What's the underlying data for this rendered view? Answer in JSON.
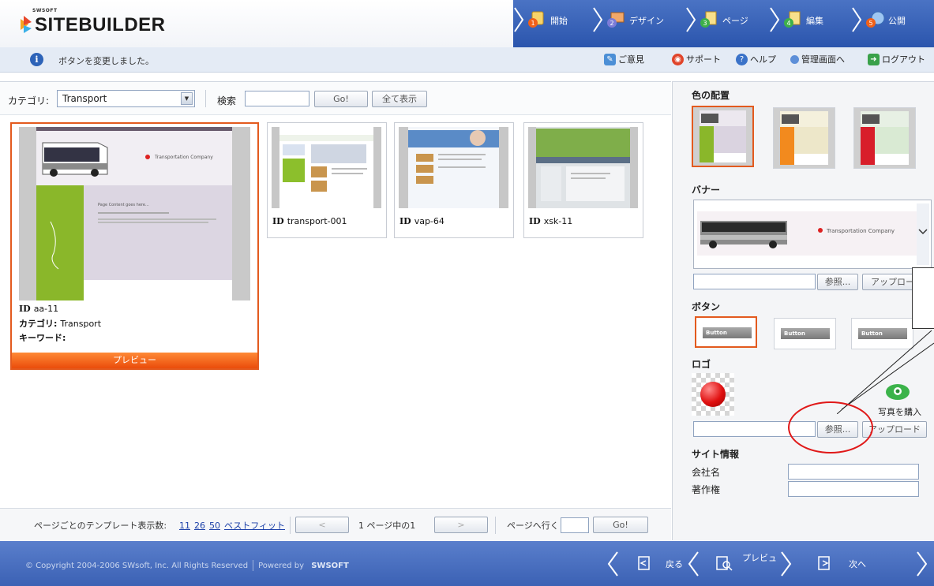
{
  "header": {
    "brand_small": "SWSOFT",
    "brand": "SITEBUILDER",
    "steps": [
      {
        "num": "1",
        "label": "開始"
      },
      {
        "num": "2",
        "label": "デザイン"
      },
      {
        "num": "3",
        "label": "ページ"
      },
      {
        "num": "4",
        "label": "編集"
      },
      {
        "num": "5",
        "label": "公開"
      }
    ],
    "accent_color": "#2b55ad"
  },
  "message_bar": {
    "info_glyph": "i",
    "message": "ボタンを変更しました。",
    "links": {
      "feedback": "ご意見",
      "support": "サポート",
      "help": "ヘルプ",
      "admin": "管理画面へ",
      "logout": "ログアウト"
    }
  },
  "filter": {
    "category_label": "カテゴリ:",
    "category_value": "Transport",
    "search_label": "検索",
    "search_value": "",
    "go_button": "Go!",
    "show_all_button": "全て表示"
  },
  "templates": [
    {
      "id_label": "ID",
      "id": "aa-11",
      "category_label": "カテゴリ:",
      "category": "Transport",
      "keywords_label": "キーワード:",
      "preview_button": "プレビュー",
      "thumb_title": "Transportation Company",
      "thumb_heading": "Page Content goes here..."
    },
    {
      "id_label": "ID",
      "id": "transport-001"
    },
    {
      "id_label": "ID",
      "id": "vap-64"
    },
    {
      "id_label": "ID",
      "id": "xsk-11"
    }
  ],
  "pager": {
    "per_page_label": "ページごとのテンプレート表示数:",
    "per_page_options": [
      "11",
      "26",
      "50",
      "ベストフィット"
    ],
    "prev_button": "<",
    "page_info": "1 ページ中の1",
    "next_button": ">",
    "goto_label": "ページへ行く",
    "goto_value": "",
    "go_button": "Go!"
  },
  "side": {
    "colors_title": "色の配置",
    "banner_title": "バナー",
    "banner_text": "Transportation Company",
    "browse_button": "参照...",
    "upload_button": "アップロード",
    "buttons_title": "ボタン",
    "button_sample": "Button",
    "logo_title": "ロゴ",
    "buy_photo": "写真を購入",
    "site_info_title": "サイト情報",
    "company_label": "会社名",
    "copyright_label": "著作権",
    "company_value": "",
    "copyright_value": ""
  },
  "footer": {
    "copyright": "© Copyright 2004-2006 SWsoft, Inc. All Rights Reserved",
    "powered_by": "Powered by",
    "powered_brand": "SWSOFT",
    "back": "戻る",
    "preview": "プレビュ",
    "next": "次へ"
  }
}
